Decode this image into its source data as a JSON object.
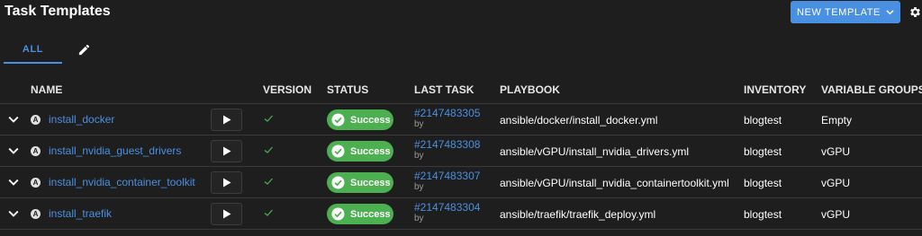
{
  "header": {
    "title": "Task Templates",
    "new_template_label": "NEW TEMPLATE",
    "settings_icon": "gear-icon"
  },
  "tabs": [
    {
      "label": "ALL",
      "active": true
    },
    {
      "icon": "pencil-icon"
    }
  ],
  "columns": {
    "name": "NAME",
    "version": "VERSION",
    "status": "STATUS",
    "last_task": "LAST TASK",
    "playbook": "PLAYBOOK",
    "inventory": "INVENTORY",
    "variable_groups": "VARIABLE GROUPS"
  },
  "rows": [
    {
      "badge": "A",
      "name": "install_docker",
      "status": "Success",
      "last_task": "#2147483305",
      "by": "by",
      "playbook": "ansible/docker/install_docker.yml",
      "inventory": "blogtest",
      "variable_groups": "Empty"
    },
    {
      "badge": "A",
      "name": "install_nvidia_guest_drivers",
      "status": "Success",
      "last_task": "#2147483308",
      "by": "by",
      "playbook": "ansible/vGPU/install_nvidia_drivers.yml",
      "inventory": "blogtest",
      "variable_groups": "vGPU"
    },
    {
      "badge": "A",
      "name": "install_nvidia_container_toolkit",
      "status": "Success",
      "last_task": "#2147483307",
      "by": "by",
      "playbook": "ansible/vGPU/install_nvidia_containertoolkit.yml",
      "inventory": "blogtest",
      "variable_groups": "vGPU"
    },
    {
      "badge": "A",
      "name": "install_traefik",
      "status": "Success",
      "last_task": "#2147483304",
      "by": "by",
      "playbook": "ansible/traefik/traefik_deploy.yml",
      "inventory": "blogtest",
      "variable_groups": "vGPU"
    }
  ],
  "colors": {
    "accent": "#4a90e2",
    "success": "#4caf50",
    "background": "#1e1e1e"
  }
}
